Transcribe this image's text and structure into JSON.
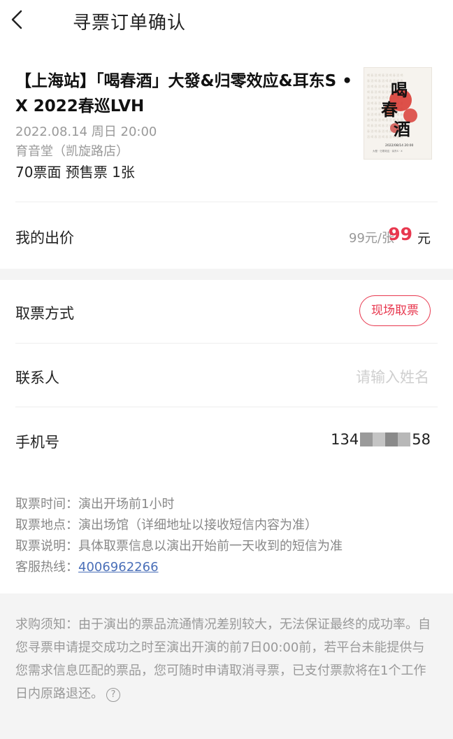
{
  "header": {
    "title": "寻票订单确认"
  },
  "show": {
    "title": "【上海站】「喝春酒」大發&归零效应&耳东S • X 2022春巡LVH",
    "datetime": "2022.08.14 周日 20:00",
    "venue": "育音堂（凯旋路店）",
    "ticket": "70票面 预售票 1张",
    "poster_title": "喝春酒",
    "poster_date": "2022/08/14 20:00"
  },
  "bid": {
    "label": "我的出价",
    "unit_price": "99元/张",
    "price": "99",
    "currency": "元"
  },
  "form": {
    "pickup_label": "取票方式",
    "pickup_value": "现场取票",
    "contact_label": "联系人",
    "contact_placeholder": "请输入姓名",
    "phone_label": "手机号",
    "phone_prefix": "134",
    "phone_suffix": "58"
  },
  "info": {
    "time": "取票时间：演出开场前1小时",
    "place": "取票地点：演出场馆（详细地址以接收短信内容为准）",
    "desc": "取票说明：具体取票信息以演出开始前一天收到的短信为准",
    "hotline_label": "客服热线：",
    "hotline": "4006962266"
  },
  "notice": {
    "text": "求购须知：由于演出的票品流通情况差别较大，无法保证最终的成功率。自您寻票申请提交成功之时至演出开演的前7日00:00前，若平台未能提供与您需求信息匹配的票品，您可随时申请取消寻票，已支付票款将在1个工作日内原路退还。",
    "help_icon": "?"
  },
  "colors": {
    "accent": "#e8384f",
    "link": "#4a6fb8"
  }
}
